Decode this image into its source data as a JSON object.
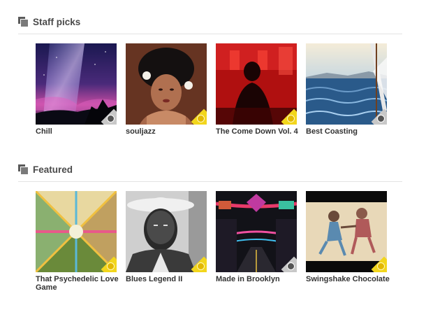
{
  "sections": [
    {
      "title": "Staff picks",
      "icon": "stack-icon",
      "items": [
        {
          "title": "Chill",
          "badge": "gray"
        },
        {
          "title": "souljazz",
          "badge": "yellow"
        },
        {
          "title": "The Come Down Vol. 4",
          "badge": "yellow"
        },
        {
          "title": "Best Coasting",
          "badge": "gray"
        }
      ]
    },
    {
      "title": "Featured",
      "icon": "stack-icon",
      "items": [
        {
          "title": "That Psychedelic Love Game",
          "badge": "yellow"
        },
        {
          "title": "Blues Legend II",
          "badge": "yellow"
        },
        {
          "title": "Made in Brooklyn",
          "badge": "gray"
        },
        {
          "title": "Swingshake Chocolate",
          "badge": "yellow"
        }
      ]
    }
  ],
  "colors": {
    "badge_yellow": "#f2d61c",
    "badge_gray": "#c8c8c8",
    "divider": "#e3e3e3"
  }
}
